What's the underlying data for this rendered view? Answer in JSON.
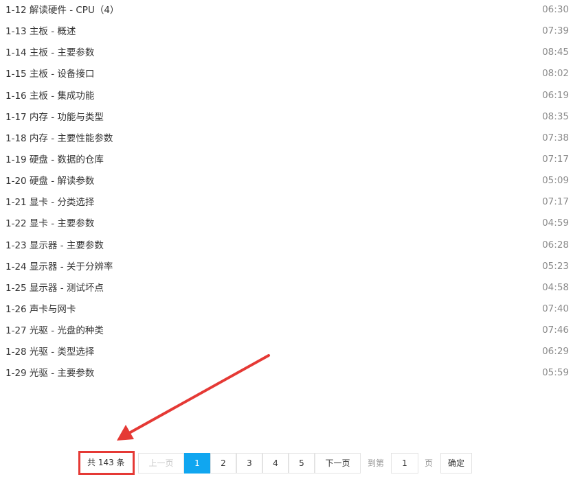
{
  "lessons": [
    {
      "title": "1-12 解读硬件 - CPU（4）",
      "duration": "06:30"
    },
    {
      "title": "1-13 主板 - 概述",
      "duration": "07:39"
    },
    {
      "title": "1-14 主板 - 主要参数",
      "duration": "08:45"
    },
    {
      "title": "1-15 主板 - 设备接口",
      "duration": "08:02"
    },
    {
      "title": "1-16 主板 - 集成功能",
      "duration": "06:19"
    },
    {
      "title": "1-17 内存 - 功能与类型",
      "duration": "08:35"
    },
    {
      "title": "1-18 内存 - 主要性能参数",
      "duration": "07:38"
    },
    {
      "title": "1-19 硬盘 - 数据的仓库",
      "duration": "07:17"
    },
    {
      "title": "1-20 硬盘 - 解读参数",
      "duration": "05:09"
    },
    {
      "title": "1-21 显卡 - 分类选择",
      "duration": "07:17"
    },
    {
      "title": "1-22 显卡 - 主要参数",
      "duration": "04:59"
    },
    {
      "title": "1-23 显示器 - 主要参数",
      "duration": "06:28"
    },
    {
      "title": "1-24 显示器 - 关于分辨率",
      "duration": "05:23"
    },
    {
      "title": "1-25 显示器 - 测试坏点",
      "duration": "04:58"
    },
    {
      "title": "1-26 声卡与网卡",
      "duration": "07:40"
    },
    {
      "title": "1-27 光驱 - 光盘的种类",
      "duration": "07:46"
    },
    {
      "title": "1-28 光驱 - 类型选择",
      "duration": "06:29"
    },
    {
      "title": "1-29 光驱 - 主要参数",
      "duration": "05:59"
    }
  ],
  "pagination": {
    "total_label": "共 143 条",
    "prev_label": "上一页",
    "pages": [
      "1",
      "2",
      "3",
      "4",
      "5"
    ],
    "current_page": "1",
    "next_label": "下一页",
    "goto_label": "到第",
    "goto_value": "1",
    "page_unit_label": "页",
    "confirm_label": "确定"
  },
  "colors": {
    "active_page": "#10a6f0",
    "annotation": "#e53935",
    "duration_text": "#8a8a8a"
  }
}
